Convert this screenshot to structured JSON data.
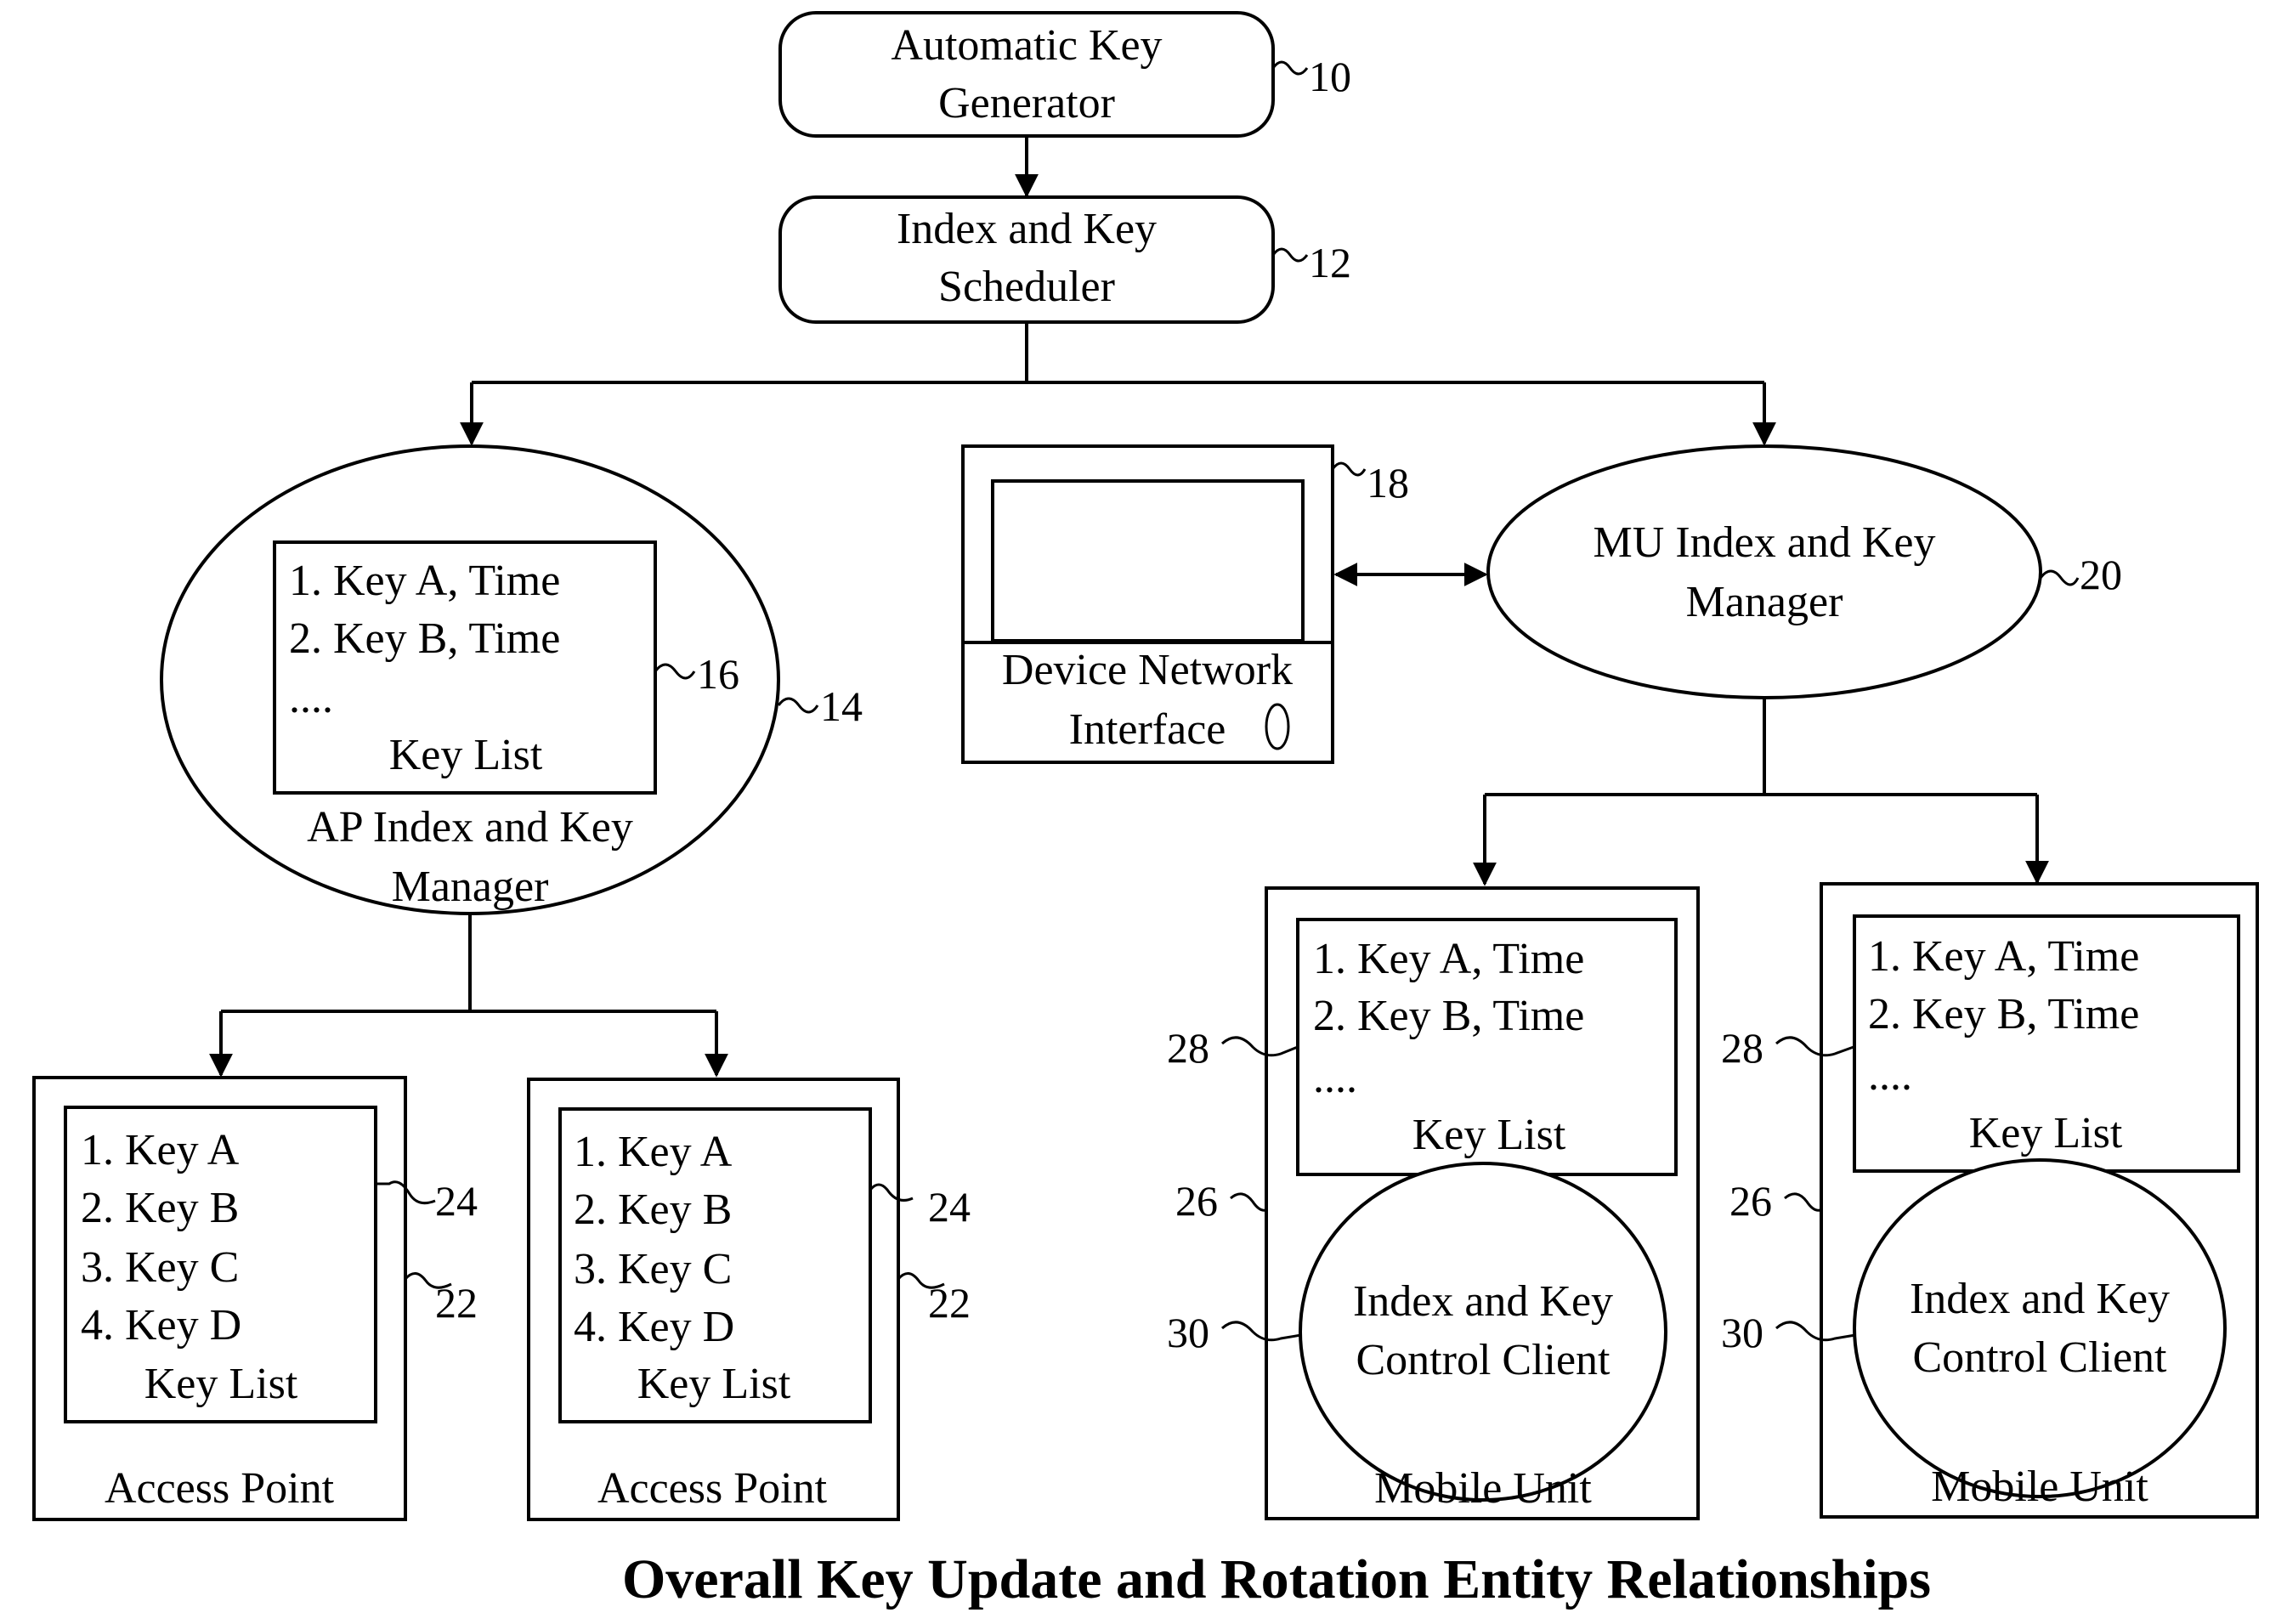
{
  "figure_title": "Overall Key Update and Rotation Entity Relationships",
  "nodes": {
    "key_generator": {
      "lines": [
        "Automatic Key",
        "Generator"
      ],
      "ref": "10"
    },
    "scheduler": {
      "lines": [
        "Index and Key",
        "Scheduler"
      ],
      "ref": "12"
    },
    "ap_manager": {
      "lines": [
        "AP Index and Key",
        "Manager"
      ],
      "ref": "14",
      "key_list": {
        "items": [
          "1. Key A, Time",
          "2. Key B, Time",
          "...."
        ],
        "caption": "Key List",
        "ref": "16"
      }
    },
    "device_network_interface": {
      "lines": [
        "Device Network",
        "Interface"
      ],
      "ref": "18"
    },
    "mu_manager": {
      "lines": [
        "MU Index and Key",
        "Manager"
      ],
      "ref": "20"
    },
    "access_points": [
      {
        "label": "Access Point",
        "ref": "22",
        "key_list": {
          "items": [
            "1. Key A",
            "2. Key B",
            "3. Key C",
            "4. Key D"
          ],
          "caption": "Key List",
          "ref": "24"
        }
      },
      {
        "label": "Access Point",
        "ref": "22",
        "key_list": {
          "items": [
            "1. Key A",
            "2. Key B",
            "3. Key C",
            "4. Key D"
          ],
          "caption": "Key List",
          "ref": "24"
        }
      }
    ],
    "mobile_units": [
      {
        "label": "Mobile Unit",
        "ref": "26",
        "key_list": {
          "items": [
            "1. Key A, Time",
            "2. Key B, Time",
            "...."
          ],
          "caption": "Key List",
          "ref": "28"
        },
        "client": {
          "lines": [
            "Index and Key",
            "Control Client"
          ],
          "ref": "30"
        }
      },
      {
        "label": "Mobile Unit",
        "ref": "26",
        "key_list": {
          "items": [
            "1. Key A, Time",
            "2. Key B, Time",
            "...."
          ],
          "caption": "Key List",
          "ref": "28"
        },
        "client": {
          "lines": [
            "Index and Key",
            "Control Client"
          ],
          "ref": "30"
        }
      }
    ]
  }
}
